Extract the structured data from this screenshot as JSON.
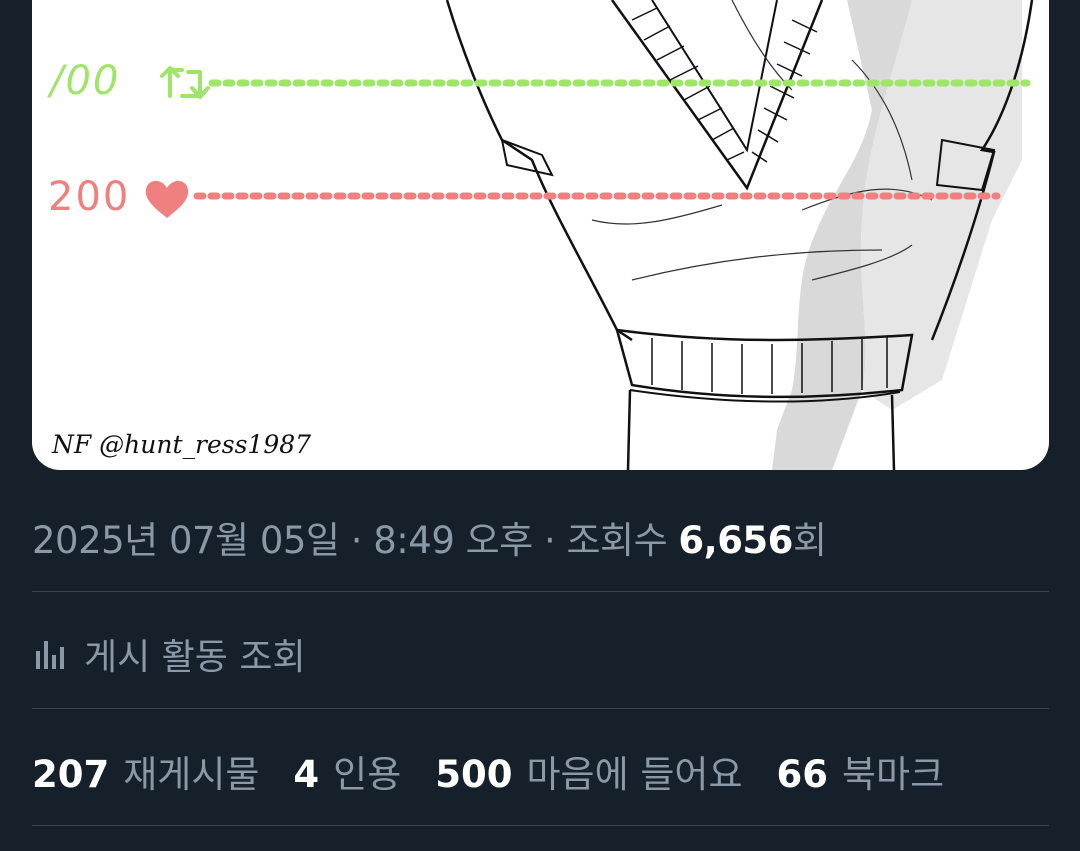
{
  "image": {
    "goal_retweets_text": "/00",
    "goal_likes_text": "200",
    "signature": "NF @hunt_ress1987",
    "retweet_line_color": "#9fe56a",
    "like_line_color": "#f08080"
  },
  "post_meta": {
    "date": "2025년 07월 05일",
    "separator": "·",
    "time": "8:49 오후",
    "views_prefix": "조회수",
    "views_count": "6,656",
    "views_suffix": "회"
  },
  "activity": {
    "icon": "bar-chart-icon",
    "label": "게시 활동 조회"
  },
  "stats": [
    {
      "count": "207",
      "label": "재게시물"
    },
    {
      "count": "4",
      "label": "인용"
    },
    {
      "count": "500",
      "label": "마음에 들어요"
    },
    {
      "count": "66",
      "label": "북마크"
    }
  ],
  "colors": {
    "background": "#15202b",
    "muted_text": "#8b98a5",
    "divider": "#38444d"
  }
}
